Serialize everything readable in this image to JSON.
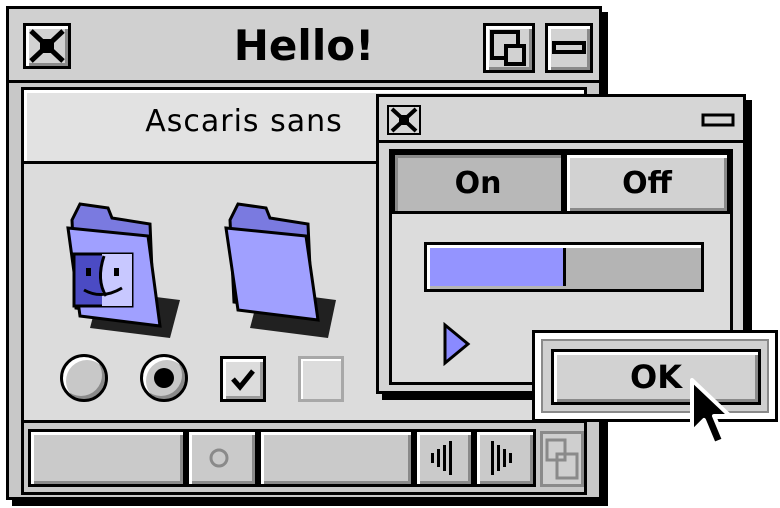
{
  "main_window": {
    "title": "Hello!",
    "close_icon": "close-box-icon",
    "zoom_icon": "zoom-box-icon",
    "collapse_icon": "windowshade-icon",
    "font_label": "Ascaris sans",
    "icons": [
      {
        "name": "finder-folder-icon"
      },
      {
        "name": "folder-icon"
      }
    ],
    "controls": {
      "radio_1_selected": false,
      "radio_2_selected": true,
      "checkbox_1_checked": true,
      "checkbox_2_enabled": false
    }
  },
  "sub_window": {
    "close_icon": "close-box-icon",
    "collapse_icon": "windowshade-icon",
    "segments": [
      {
        "label": "On",
        "selected": true
      },
      {
        "label": "Off",
        "selected": false
      }
    ],
    "progress_fraction": 0.5,
    "disclosure_icon": "disclosure-triangle-icon"
  },
  "dialog": {
    "ok_label": "OK"
  },
  "colors": {
    "accent": "#9494ff",
    "window_bg": "#c8c8c8",
    "frame": "#000000"
  }
}
